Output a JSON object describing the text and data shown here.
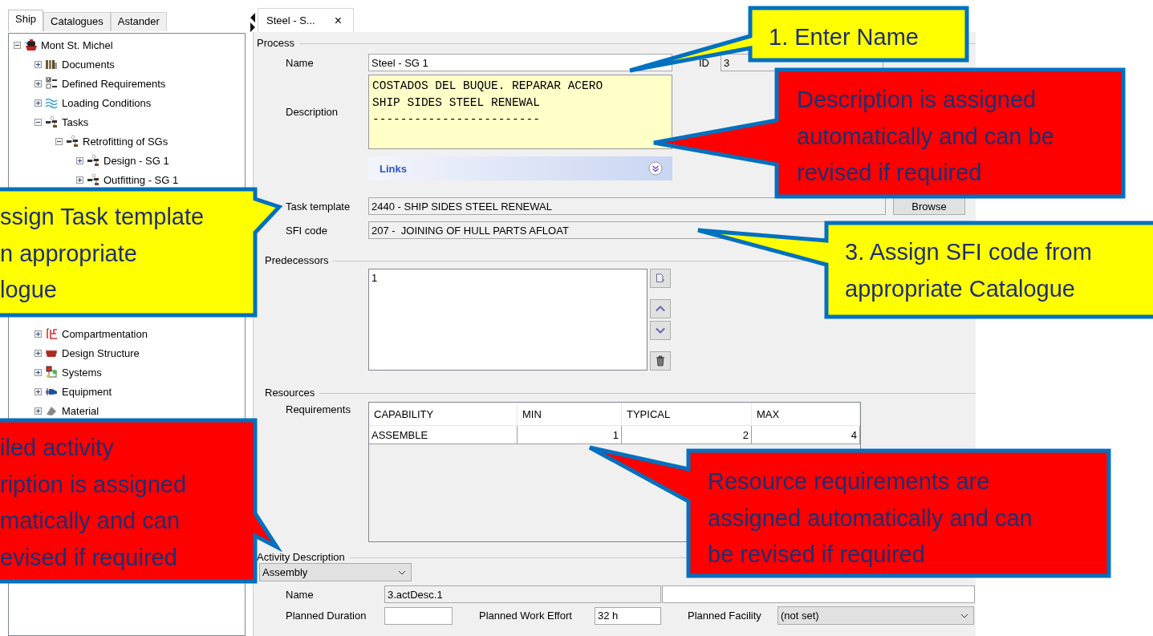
{
  "left_tabs": [
    {
      "label": "Ship",
      "selected": true
    },
    {
      "label": "Catalogues",
      "selected": false
    },
    {
      "label": "Astander",
      "selected": false
    }
  ],
  "tree": {
    "label": "Mont St. Michel",
    "expanded": true,
    "children": [
      {
        "label": "Documents",
        "expanded": false
      },
      {
        "label": "Defined Requirements",
        "expanded": false
      },
      {
        "label": "Loading Conditions",
        "expanded": false
      },
      {
        "label": "Tasks",
        "expanded": true,
        "children": [
          {
            "label": "Retrofitting of SGs",
            "expanded": true,
            "children": [
              {
                "label": "Design - SG 1",
                "expanded": false
              },
              {
                "label": "Outfitting - SG 1",
                "expanded": false
              }
            ]
          }
        ]
      },
      {
        "label": "Compartmentation",
        "expanded": false
      },
      {
        "label": "Design Structure",
        "expanded": false
      },
      {
        "label": "Systems",
        "expanded": false
      },
      {
        "label": "Equipment",
        "expanded": false
      },
      {
        "label": "Material",
        "expanded": false
      }
    ]
  },
  "editor_tabs": [
    {
      "label": "Steel - S...",
      "close": "×",
      "selected": true
    }
  ],
  "process": {
    "title": "Process",
    "name_label": "Name",
    "name": "Steel - SG 1",
    "id_label": "ID",
    "id": "3",
    "description_label": "Description",
    "description": "COSTADOS DEL BUQUE. REPARAR ACERO\nSHIP SIDES STEEL RENEWAL\n------------------------",
    "links": "Links",
    "task_template_label": "Task template",
    "task_template": "2440 - SHIP SIDES STEEL RENEWAL",
    "browse": "Browse",
    "sfi_label": "SFI code",
    "sfi": "207 -  JOINING OF HULL PARTS AFLOAT"
  },
  "predecessors": {
    "title": "Predecessors",
    "items": [
      "1"
    ]
  },
  "resources": {
    "title": "Resources",
    "requirements_label": "Requirements",
    "columns": [
      "CAPABILITY",
      "MIN",
      "TYPICAL",
      "MAX"
    ],
    "rows": [
      [
        "ASSEMBLE",
        "1",
        "2",
        "4"
      ]
    ]
  },
  "activity": {
    "title": "Activity Description",
    "type": "Assembly",
    "name_label": "Name",
    "name": "3.actDesc.1",
    "duration_label": "Planned Duration",
    "effort_label": "Planned Work Effort",
    "effort": "32 h",
    "facility_label": "Planned Facility",
    "facility": "(not set)"
  },
  "callouts": [
    {
      "color": "#ffff00",
      "lines": [
        "1. Enter Name"
      ]
    },
    {
      "color": "#ff0000",
      "lines": [
        "Description is assigned",
        "automatically and can be",
        "revised if required"
      ]
    },
    {
      "color": "#ffff00",
      "lines": [
        "ssign Task template",
        "n appropriate",
        "logue"
      ]
    },
    {
      "color": "#ffff00",
      "lines": [
        "3. Assign SFI code from",
        "appropriate Catalogue"
      ]
    },
    {
      "color": "#ff0000",
      "lines": [
        "iled activity",
        "ription is assigned",
        "matically and can",
        "evised if required"
      ]
    },
    {
      "color": "#ff0000",
      "lines": [
        "Resource requirements are",
        "assigned automatically and can",
        "be revised if required"
      ]
    }
  ]
}
